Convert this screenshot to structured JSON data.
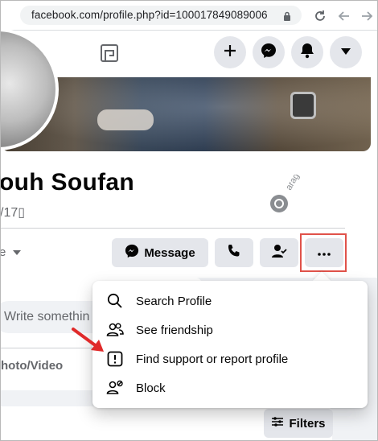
{
  "browser": {
    "url": "facebook.com/profile.php?id=100017849089006"
  },
  "header": {
    "icons": [
      "groups-icon",
      "gaming-icon",
      "plus-icon",
      "messenger-icon",
      "notifications-icon",
      "caret-down-icon"
    ]
  },
  "profile": {
    "name": "ouh Soufan",
    "friends": "/17▯",
    "friends_dropdown": "e"
  },
  "watermark": {
    "text": "arageek مجلة"
  },
  "actions": {
    "message_label": "Message",
    "call_icon": "phone-icon",
    "friend_icon": "friend-check-icon",
    "more_icon": "more-dots-icon"
  },
  "composer": {
    "write_placeholder": "Write somethin",
    "photo_label": "hoto/Video"
  },
  "posts": {
    "filters_label": "Filters"
  },
  "menu": {
    "items": [
      {
        "label": "Search Profile",
        "icon": "search-icon"
      },
      {
        "label": "See friendship",
        "icon": "friendship-icon"
      },
      {
        "label": "Find support or report profile",
        "icon": "report-icon"
      },
      {
        "label": "Block",
        "icon": "block-user-icon"
      }
    ]
  },
  "colors": {
    "highlight": "#e0524a",
    "arrow": "#e02a2a",
    "button_bg": "#e4e6eb"
  }
}
